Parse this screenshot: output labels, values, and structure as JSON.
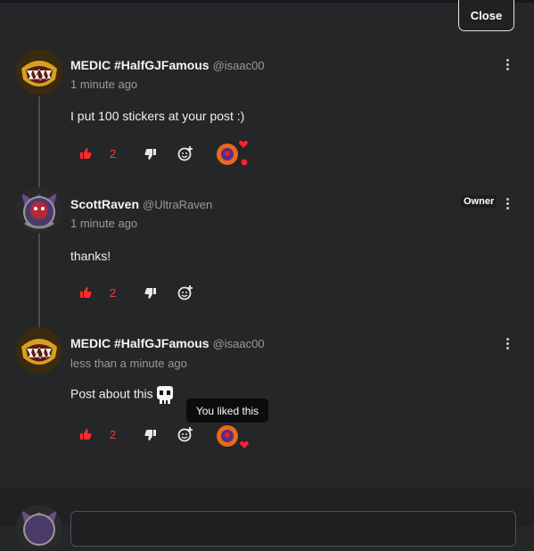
{
  "close_label": "Close",
  "comments": [
    {
      "author": "MEDIC #HalfGJFamous",
      "handle": "@isaac00",
      "time": "1 minute ago",
      "text": "I put 100 stickers at your post :)",
      "like_count": "2",
      "avatar": "monster-mouth-avatar"
    },
    {
      "author": "ScottRaven",
      "handle": "@UltraRaven",
      "time": "1 minute ago",
      "text": "thanks!",
      "like_count": "2",
      "badge": "Owner",
      "avatar": "raven-emblem-avatar"
    },
    {
      "author": "MEDIC #HalfGJFamous",
      "handle": "@isaac00",
      "time": "less than a minute ago",
      "text": "Post about this",
      "like_count": "2",
      "avatar": "monster-mouth-avatar"
    }
  ],
  "tooltip": "You liked this",
  "colors": {
    "accent_red": "#ff2a2a",
    "background": "#242628"
  }
}
